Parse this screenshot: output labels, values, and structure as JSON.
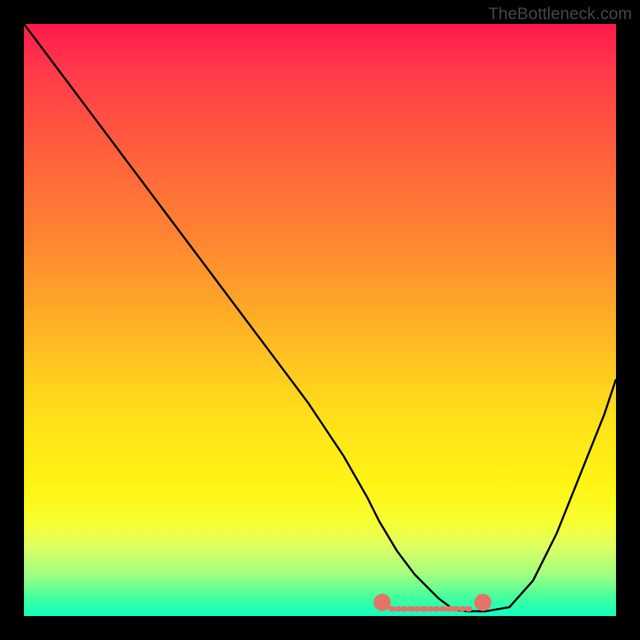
{
  "watermark": "TheBottleneck.com",
  "chart_data": {
    "type": "line",
    "title": "",
    "xlabel": "",
    "ylabel": "",
    "xlim": [
      0,
      100
    ],
    "ylim": [
      0,
      100
    ],
    "series": [
      {
        "name": "bottleneck-curve",
        "x": [
          0,
          6,
          12,
          18,
          24,
          30,
          36,
          42,
          48,
          54,
          58,
          60,
          63,
          66,
          70,
          72,
          73,
          75,
          78,
          82,
          86,
          90,
          94,
          98,
          100
        ],
        "values": [
          100,
          92,
          84,
          76,
          68,
          60,
          52,
          44,
          36,
          27,
          20,
          16,
          11,
          7,
          3,
          1.5,
          1,
          0.8,
          0.8,
          1.5,
          6,
          14,
          24,
          34,
          40
        ]
      }
    ],
    "markers": [
      {
        "name": "range-start",
        "x": 60.5,
        "y": 2.3,
        "color": "#e57368",
        "r": 1.2
      },
      {
        "name": "range-end",
        "x": 77.5,
        "y": 2.3,
        "color": "#e57368",
        "r": 1.2
      }
    ],
    "highlight_segment": {
      "x_start": 62,
      "x_end": 76,
      "y": 1.2,
      "color": "#e57368"
    },
    "gradient_stops": [
      {
        "pos": 0,
        "color": "#ff1a4a"
      },
      {
        "pos": 50,
        "color": "#ffc820"
      },
      {
        "pos": 80,
        "color": "#fff414"
      },
      {
        "pos": 100,
        "color": "#10ffc0"
      }
    ]
  }
}
